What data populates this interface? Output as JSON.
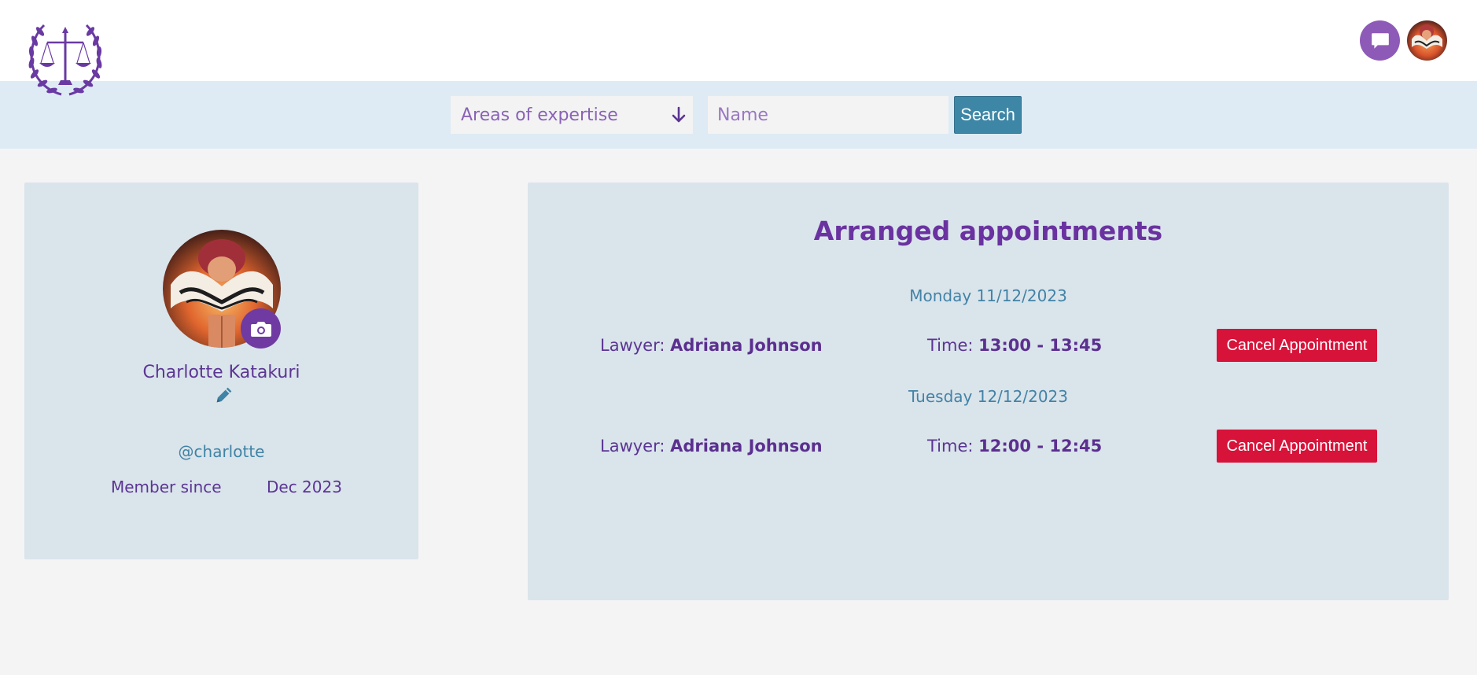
{
  "search": {
    "expertise_placeholder": "Areas of expertise",
    "name_placeholder": "Name",
    "button_label": "Search"
  },
  "header": {
    "chat_icon": "chat-bubble-icon",
    "logo_icon": "scales-of-justice-laurel-logo"
  },
  "profile": {
    "name": "Charlotte Katakuri",
    "username": "@charlotte",
    "member_since_label": "Member since",
    "member_since_value": "Dec 2023",
    "camera_icon": "camera-icon",
    "edit_icon": "pencil-icon"
  },
  "appointments": {
    "title": "Arranged appointments",
    "items": [
      {
        "date": "Monday 11/12/2023",
        "lawyer_label": "Lawyer:",
        "lawyer_name": "Adriana Johnson",
        "time_label": "Time:",
        "time_range": "13:00 - 13:45",
        "cancel_label": "Cancel Appointment"
      },
      {
        "date": "Tuesday 12/12/2023",
        "lawyer_label": "Lawyer:",
        "lawyer_name": "Adriana Johnson",
        "time_label": "Time:",
        "time_range": "12:00 - 12:45",
        "cancel_label": "Cancel Appointment"
      }
    ]
  },
  "colors": {
    "accent_purple": "#6a32a0",
    "link_blue": "#3d86a6",
    "danger_red": "#d7133a",
    "card_bg": "#dae4eb"
  }
}
